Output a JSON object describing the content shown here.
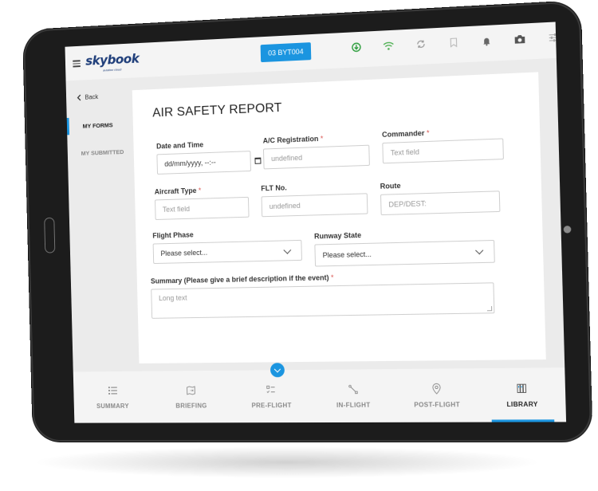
{
  "app": {
    "name": "skybook",
    "tagline": "aviation cloud",
    "flight_id": "03 BYT004"
  },
  "status_icons": [
    {
      "name": "download-icon",
      "color": "#2e9e3e"
    },
    {
      "name": "wifi-icon",
      "color": "#4caf50"
    },
    {
      "name": "sync-icon",
      "color": "#999999"
    },
    {
      "name": "bookmark-icon",
      "color": "#bbbbbb"
    },
    {
      "name": "bell-icon",
      "color": "#666666"
    },
    {
      "name": "camera-icon",
      "color": "#555555"
    },
    {
      "name": "settings-sliders-icon",
      "color": "#999999"
    }
  ],
  "sidebar": {
    "back_label": "Back",
    "items": [
      {
        "label": "MY FORMS",
        "active": true
      },
      {
        "label": "MY SUBMITTED",
        "active": false
      }
    ]
  },
  "form": {
    "title": "AIR SAFETY REPORT",
    "fields": {
      "date_time": {
        "label": "Date and Time",
        "required": false,
        "value": "dd/mm/yyyy, --:--"
      },
      "ac_registration": {
        "label": "A/C Registration",
        "required": true,
        "placeholder": "undefined"
      },
      "commander": {
        "label": "Commander",
        "required": true,
        "placeholder": "Text field"
      },
      "aircraft_type": {
        "label": "Aircraft Type",
        "required": true,
        "placeholder": "Text field"
      },
      "flt_no": {
        "label": "FLT No.",
        "required": false,
        "placeholder": "undefined"
      },
      "route": {
        "label": "Route",
        "required": false,
        "placeholder": "DEP/DEST:"
      },
      "flight_phase": {
        "label": "Flight Phase",
        "required": false,
        "selected": "Please select..."
      },
      "runway_state": {
        "label": "Runway State",
        "required": false,
        "selected": "Please select..."
      },
      "summary": {
        "label": "Summary (Please give a brief description if the event)",
        "required": true,
        "placeholder": "Long text"
      }
    },
    "required_marker": "*"
  },
  "bottom_nav": [
    {
      "label": "SUMMARY",
      "icon": "list-icon",
      "active": false
    },
    {
      "label": "BRIEFING",
      "icon": "map-icon",
      "active": false
    },
    {
      "label": "PRE-FLIGHT",
      "icon": "checklist-icon",
      "active": false
    },
    {
      "label": "IN-FLIGHT",
      "icon": "route-icon",
      "active": false
    },
    {
      "label": "POST-FLIGHT",
      "icon": "location-pin-icon",
      "active": false
    },
    {
      "label": "LIBRARY",
      "icon": "library-icon",
      "active": true
    }
  ],
  "colors": {
    "accent": "#1b95e0",
    "required": "#d9534f",
    "logo": "#1f3e7a"
  }
}
